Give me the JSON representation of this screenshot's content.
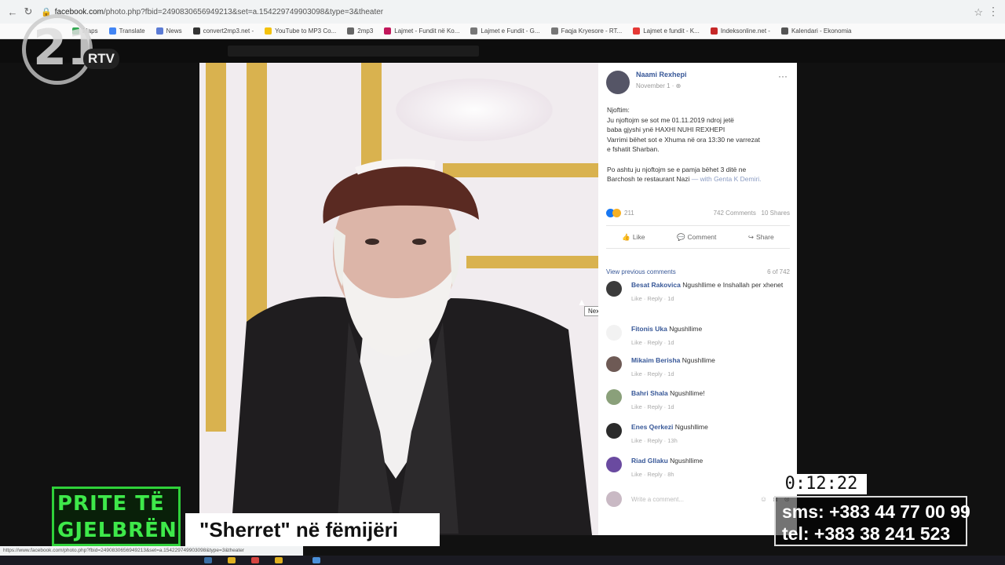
{
  "browser": {
    "url_host": "facebook.com",
    "url_rest": "/photo.php?fbid=2490830656949213&set=a.154229749903098&type=3&theater",
    "bookmarks": [
      {
        "label": "Maps",
        "color": "#34a853"
      },
      {
        "label": "Translate",
        "color": "#4285f4"
      },
      {
        "label": "News",
        "color": "#5b7bd5"
      },
      {
        "label": "convert2mp3.net -",
        "color": "#333333"
      },
      {
        "label": "YouTube to MP3 Co...",
        "color": "#f4c20d"
      },
      {
        "label": "2mp3",
        "color": "#666666"
      },
      {
        "label": "Lajmet - Fundit në Ko...",
        "color": "#c2185b"
      },
      {
        "label": "Lajmet e Fundit - G...",
        "color": "#777777"
      },
      {
        "label": "Faqja Kryesore - RT...",
        "color": "#777777"
      },
      {
        "label": "Lajmet e fundit - K...",
        "color": "#e53935"
      },
      {
        "label": "Indeksonline.net -",
        "color": "#c62828"
      },
      {
        "label": "Kalendari - Ekonomia",
        "color": "#555555"
      }
    ]
  },
  "tv": {
    "channel_num": "21",
    "channel_brand": "RTV",
    "show_line1": "PRITE TË",
    "show_line2": "GJELBRËN",
    "headline": "\"Sherret\" në fëmijëri",
    "clock": "0:12:22",
    "sms": "sms: +383 44 77 00 99",
    "tel": "tel:   +383 38 241 523"
  },
  "photo": {
    "tooltip": "Next"
  },
  "post": {
    "author": "Naami Rexhepi",
    "date": "November 1 · ⊕",
    "p1_l1": "Njoftim:",
    "p1_l2": "Ju njoftojm se sot me 01.11.2019 ndroj jetë",
    "p1_l3": "baba gjyshi ynë HAXHI NUHI REXHEPI",
    "p1_l4": "Varrimi bëhet sot e Xhuma në ora 13:30 ne varrezat",
    "p1_l5": "e fshatit Sharban.",
    "p2_l1": "Po ashtu ju njoftojm se e pamja bëhet 3 ditë ne",
    "p2_l2": "Barchosh te restaurant Nazi",
    "p2_tag": "— with Genta K Demiri.",
    "reactions": "211",
    "comments_count": "742 Comments",
    "shares": "10 Shares",
    "like": "Like",
    "comment": "Comment",
    "share": "Share",
    "view_prev": "View previous comments",
    "pager": "6 of 742",
    "comments": [
      {
        "name": "Besat Rakovica",
        "text": "Ngushllime e Inshallah per xhenet",
        "meta": "Like · Reply · 1d"
      },
      {
        "name": "Fitonis Uka",
        "text": "Ngushllime",
        "meta": "Like · Reply · 1d"
      },
      {
        "name": "Mikaim Berisha",
        "text": "Ngushllime",
        "meta": "Like · Reply · 1d"
      },
      {
        "name": "Bahri Shala",
        "text": "Ngushllime!",
        "meta": "Like · Reply · 1d"
      },
      {
        "name": "Enes Qerkezi",
        "text": "Ngushllime",
        "meta": "Like · Reply · 13h"
      },
      {
        "name": "Riad Gllaku",
        "text": "Ngushllime",
        "meta": "Like · Reply · 8h"
      }
    ],
    "write_placeholder": "Write a comment..."
  },
  "statusbar": "https://www.facebook.com/photo.php?fbid=2490830656949213&set=a.154229749903098&type=3&theater"
}
